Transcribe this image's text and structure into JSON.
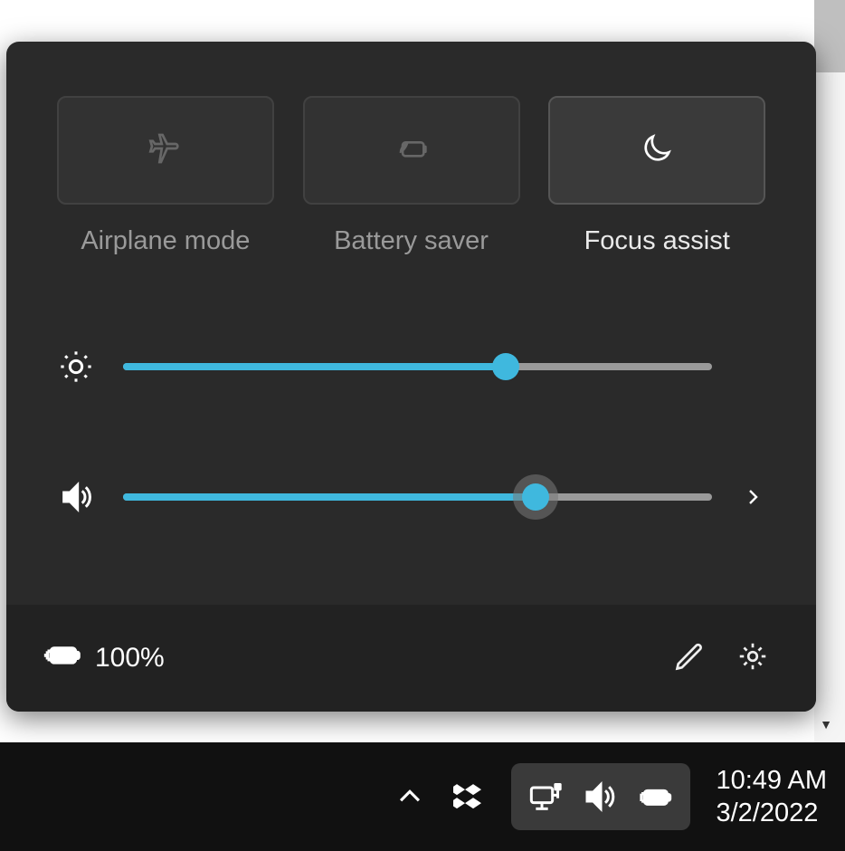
{
  "quick_actions": {
    "airplane": {
      "label": "Airplane mode",
      "enabled": false
    },
    "battery_saver": {
      "label": "Battery saver",
      "enabled": false
    },
    "focus_assist": {
      "label": "Focus assist",
      "enabled": true
    }
  },
  "sliders": {
    "brightness": {
      "value": 65
    },
    "volume": {
      "value": 70
    }
  },
  "footer": {
    "battery_text": "100%"
  },
  "taskbar": {
    "time": "10:49 AM",
    "date": "3/2/2022"
  }
}
